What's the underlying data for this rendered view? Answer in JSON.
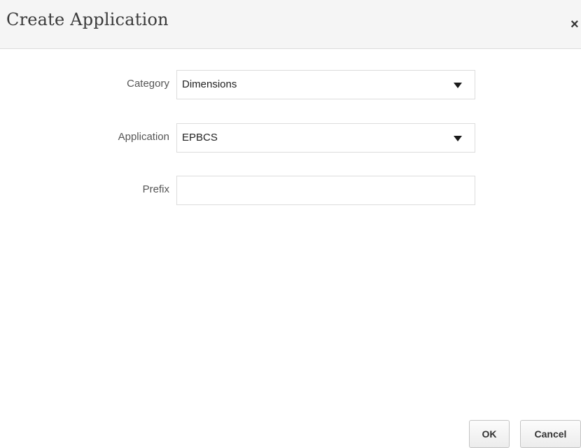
{
  "dialog": {
    "title": "Create Application",
    "close_icon": "close-icon",
    "close_glyph": "×"
  },
  "form": {
    "category": {
      "label": "Category",
      "value": "Dimensions",
      "icon": "dropdown-arrow-icon"
    },
    "application": {
      "label": "Application",
      "value": "EPBCS",
      "icon": "dropdown-arrow-icon"
    },
    "prefix": {
      "label": "Prefix",
      "value": "",
      "placeholder": ""
    }
  },
  "buttons": {
    "ok_label": "OK",
    "cancel_label": "Cancel"
  }
}
